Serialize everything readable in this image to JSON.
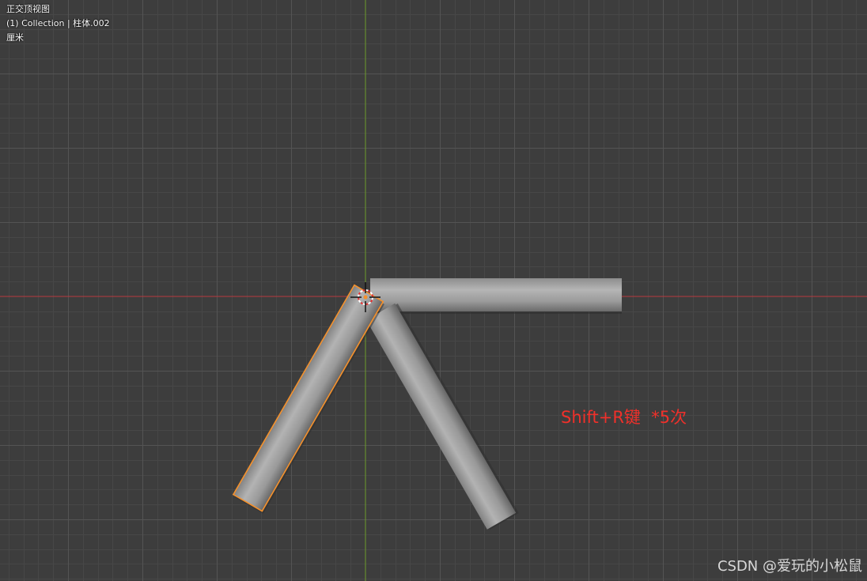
{
  "viewport": {
    "view_name": "正交顶视图",
    "collection_info": "(1) Collection | 柱体.002",
    "unit_label": "厘米"
  },
  "colors": {
    "background": "#3d3d3d",
    "grid_minor": "#474747",
    "grid_major": "#545454",
    "x_axis": "#b8393f",
    "y_axis": "#6d9a2b",
    "selection_outline": "#f5912c",
    "annotation": "#f0302a"
  },
  "objects": [
    {
      "name": "horizontal-cylinder",
      "selected": false
    },
    {
      "name": "right-slanted-cylinder",
      "selected": false
    },
    {
      "name": "left-slanted-cylinder",
      "selected": true
    }
  ],
  "cursor_icon": "3d-cursor-icon",
  "annotation": "Shift+R键  *5次",
  "watermark": "CSDN @爱玩的小松鼠"
}
